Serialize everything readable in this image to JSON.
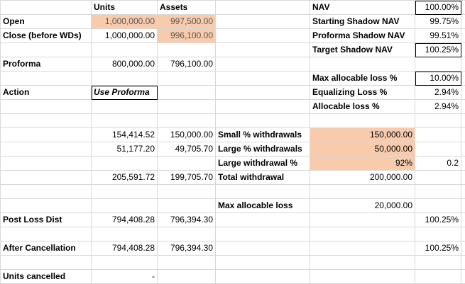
{
  "colors": {
    "highlight": "#f8cbad",
    "gridline": "#d8d8d8",
    "border": "#000000"
  },
  "rows": [
    {
      "a": "",
      "b": "Units",
      "c": "Assets",
      "d": "",
      "e": "NAV",
      "f": "",
      "g": "100.00%",
      "h": ""
    },
    {
      "a": "Open",
      "b": "1,000,000.00",
      "c": "997,500.00",
      "d": "",
      "e": "Starting Shadow NAV",
      "f": "",
      "g": "99.75%",
      "h": ""
    },
    {
      "a": "Close (before WDs)",
      "b": "1,000,000.00",
      "c": "996,100.00",
      "d": "",
      "e": "Proforma Shadow NAV",
      "f": "",
      "g": "99.51%",
      "h": ""
    },
    {
      "a": "",
      "b": "",
      "c": "",
      "d": "",
      "e": "Target Shadow NAV",
      "f": "",
      "g": "100.25%",
      "h": ""
    },
    {
      "a": "Proforma",
      "b": "800,000.00",
      "c": "796,100.00",
      "d": "",
      "e": "",
      "f": "",
      "g": "",
      "h": ""
    },
    {
      "a": "",
      "b": "",
      "c": "",
      "d": "",
      "e": "Max allocable loss %",
      "f": "",
      "g": "10.00%",
      "h": ""
    },
    {
      "a": "Action",
      "b": "Use Proforma",
      "c": "",
      "d": "",
      "e": "Equalizing Loss %",
      "f": "",
      "g": "2.94%",
      "h": ""
    },
    {
      "a": "",
      "b": "",
      "c": "",
      "d": "",
      "e": "Allocable loss %",
      "f": "",
      "g": "2.94%",
      "h": ""
    },
    {
      "a": "",
      "b": "",
      "c": "",
      "d": "",
      "e": "",
      "f": "",
      "g": "",
      "h": ""
    },
    {
      "a": "",
      "b": "154,414.52",
      "c": "150,000.00",
      "d": "Small % withdrawals",
      "e": "",
      "f": "150,000.00",
      "g": "",
      "h": ""
    },
    {
      "a": "",
      "b": "51,177.20",
      "c": "49,705.70",
      "d": "Large % withdrawals",
      "e": "",
      "f": "50,000.00",
      "g": "",
      "h": ""
    },
    {
      "a": "",
      "b": "",
      "c": "",
      "d": "Large withdrawal %",
      "e": "",
      "f": "92%",
      "g": "0.2",
      "h": ""
    },
    {
      "a": "",
      "b": "205,591.72",
      "c": "199,705.70",
      "d": "Total withdrawal",
      "e": "",
      "f": "200,000.00",
      "g": "",
      "h": ""
    },
    {
      "a": "",
      "b": "",
      "c": "",
      "d": "",
      "e": "",
      "f": "",
      "g": "",
      "h": ""
    },
    {
      "a": "",
      "b": "",
      "c": "",
      "d": "Max allocable loss",
      "e": "",
      "f": "20,000.00",
      "g": "",
      "h": ""
    },
    {
      "a": "Post Loss Dist",
      "b": "794,408.28",
      "c": "796,394.30",
      "d": "",
      "e": "",
      "f": "",
      "g": "100.25%",
      "h": ""
    },
    {
      "a": "",
      "b": "",
      "c": "",
      "d": "",
      "e": "",
      "f": "",
      "g": "",
      "h": ""
    },
    {
      "a": "After Cancellation",
      "b": "794,408.28",
      "c": "796,394.30",
      "d": "",
      "e": "",
      "f": "",
      "g": "100.25%",
      "h": ""
    },
    {
      "a": "",
      "b": "",
      "c": "",
      "d": "",
      "e": "",
      "f": "",
      "g": "",
      "h": ""
    },
    {
      "a": "Units cancelled",
      "b": "-",
      "c": "",
      "d": "",
      "e": "",
      "f": "",
      "g": "",
      "h": ""
    }
  ]
}
